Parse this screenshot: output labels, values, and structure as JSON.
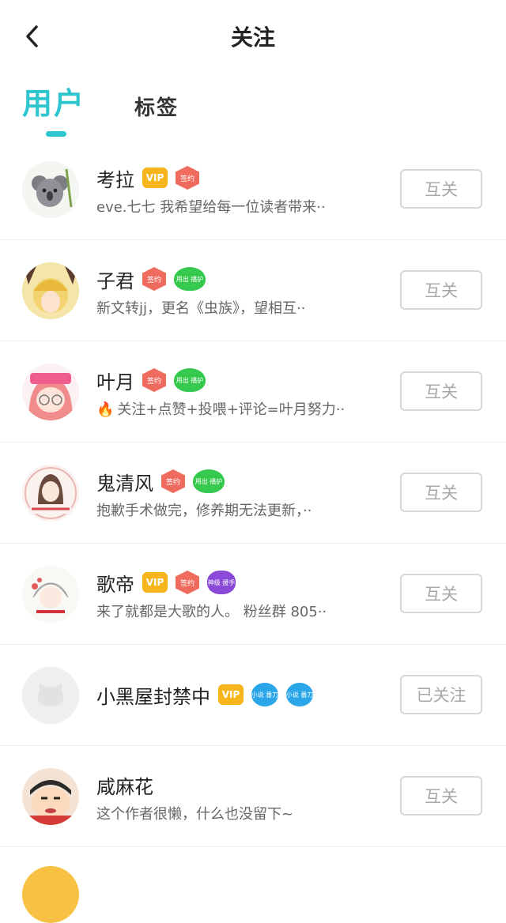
{
  "header": {
    "title": "关注"
  },
  "tabs": [
    {
      "label": "用户",
      "active": true
    },
    {
      "label": "标签",
      "active": false
    }
  ],
  "colors": {
    "accent": "#2fc5cf",
    "vip": "#f6b51b",
    "sign": "#ef6b5d",
    "green_badge": "#36c94d",
    "purple_badge": "#8b49d8",
    "blue_badge": "#2aa6e9"
  },
  "users": [
    {
      "name": "考拉",
      "bio": "eve.七七 我希望给每一位读者带来··",
      "button": "互关",
      "badges": [
        "vip",
        "sign"
      ],
      "badge_labels": {
        "vip": "VIP",
        "sign": "签约"
      }
    },
    {
      "name": "子君",
      "bio": "新文转jj，更名《虫族》，望相互··",
      "button": "互关",
      "badges": [
        "sign",
        "green"
      ],
      "badge_labels": {
        "sign": "签约",
        "green": "用出 播护"
      }
    },
    {
      "name": "叶月",
      "bio": "关注+点赞+投喂+评论=叶月努力··",
      "bio_icon": "fire-icon",
      "button": "互关",
      "badges": [
        "sign",
        "green"
      ],
      "badge_labels": {
        "sign": "签约",
        "green": "用出 播护"
      }
    },
    {
      "name": "鬼清风",
      "bio": "抱歉手术做完，修养期无法更新，··",
      "button": "互关",
      "badges": [
        "sign",
        "green"
      ],
      "badge_labels": {
        "sign": "签约",
        "green": "用出 播护"
      }
    },
    {
      "name": "歌帝",
      "bio": "来了就都是大歌的人。 粉丝群 805··",
      "button": "互关",
      "badges": [
        "vip",
        "sign",
        "purple"
      ],
      "badge_labels": {
        "vip": "VIP",
        "sign": "签约",
        "purple": "神级 援手"
      }
    },
    {
      "name": "小黑屋封禁中",
      "bio": "",
      "button": "已关注",
      "badges": [
        "vip",
        "blue",
        "blue2"
      ],
      "badge_labels": {
        "vip": "VIP",
        "blue": "小说 番刀",
        "blue2": "小说 番刀"
      }
    },
    {
      "name": "咸麻花",
      "bio": "这个作者很懒，什么也没留下~",
      "button": "互关",
      "badges": [],
      "badge_labels": {}
    }
  ]
}
